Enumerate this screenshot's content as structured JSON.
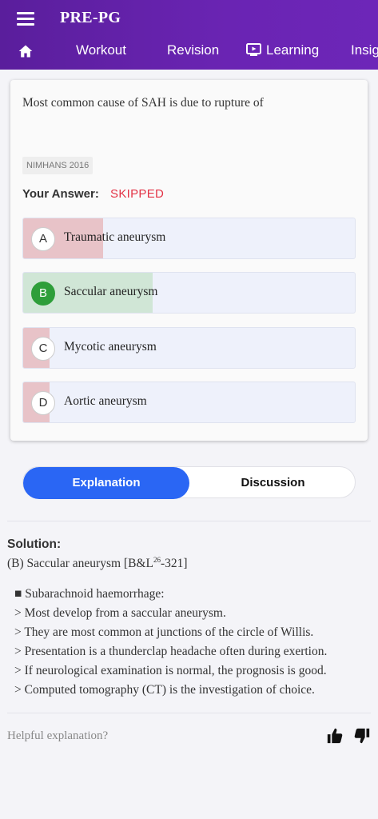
{
  "app": {
    "title": "PRE-PG"
  },
  "nav": {
    "tabs": [
      {
        "label": "Workout"
      },
      {
        "label": "Revision"
      },
      {
        "label": "Learning"
      },
      {
        "label": "Insig"
      }
    ]
  },
  "question": {
    "text": "Most common cause of SAH is due to rupture of",
    "source": "NIMHANS 2016",
    "answer_label": "Your Answer:",
    "answer_value": "SKIPPED",
    "options": [
      {
        "letter": "A",
        "text": "Traumatic aneurysm",
        "share": 0.24,
        "status": "wrong"
      },
      {
        "letter": "B",
        "text": "Saccular aneurysm",
        "share": 0.39,
        "status": "correct"
      },
      {
        "letter": "C",
        "text": "Mycotic aneurysm",
        "share": 0.08,
        "status": "wrong"
      },
      {
        "letter": "D",
        "text": "Aortic aneurysm",
        "share": 0.08,
        "status": "wrong"
      }
    ]
  },
  "tabs": {
    "explanation": "Explanation",
    "discussion": "Discussion"
  },
  "solution": {
    "title": "Solution:",
    "answer_prefix": "(B) Saccular aneurysm [B&L",
    "answer_sup": "26",
    "answer_suffix": "-321]",
    "points": [
      "■ Subarachnoid haemorrhage:",
      "> Most develop from a saccular aneurysm.",
      "> They are most common at junctions of the circle of Willis.",
      "> Presentation is a thunderclap headache often during exertion.",
      "> If neurological examination is normal, the prognosis is good.",
      "> Computed tomography (CT) is the investigation of choice."
    ]
  },
  "feedback": {
    "prompt": "Helpful explanation?"
  },
  "colors": {
    "header": "#6a24b3",
    "wrong_fill": "#e8c3c8",
    "correct_fill": "#d0e6d6",
    "correct_badge": "#2e9e3a",
    "skipped_text": "#e33346",
    "active_tab": "#2a66f4"
  }
}
